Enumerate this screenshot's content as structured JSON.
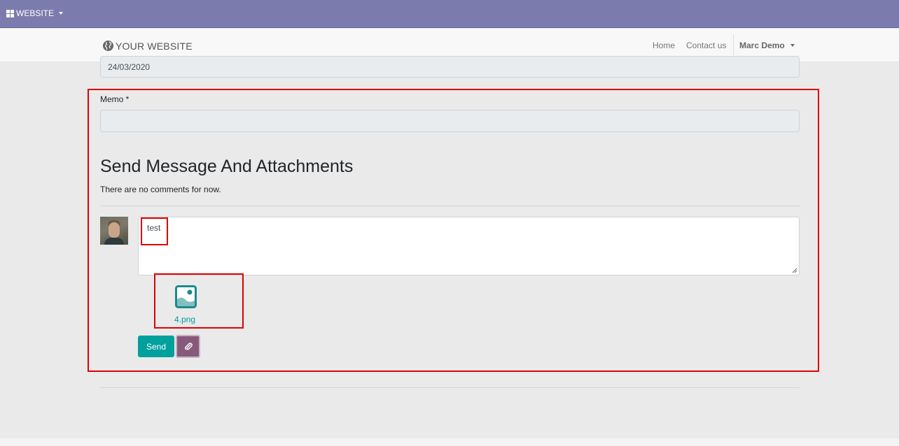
{
  "topbar": {
    "menu_label": "WEBSITE"
  },
  "navbar": {
    "brand": "YOUR WEBSITE",
    "links": [
      "Home",
      "Contact us"
    ],
    "user": "Marc Demo"
  },
  "form": {
    "date_value": "24/03/2020",
    "memo_label": "Memo *",
    "memo_value": ""
  },
  "messages": {
    "title": "Send Message And Attachments",
    "empty_text": "There are no comments for now.",
    "composer_text": "test",
    "attachment": {
      "name": "4.png",
      "icon": "image-file-icon"
    },
    "send_label": "Send",
    "attach_icon": "paperclip-icon"
  },
  "colors": {
    "topbar": "#7c7bad",
    "primary": "#00a09d",
    "secondary": "#875a7b",
    "highlight": "#e00000"
  }
}
